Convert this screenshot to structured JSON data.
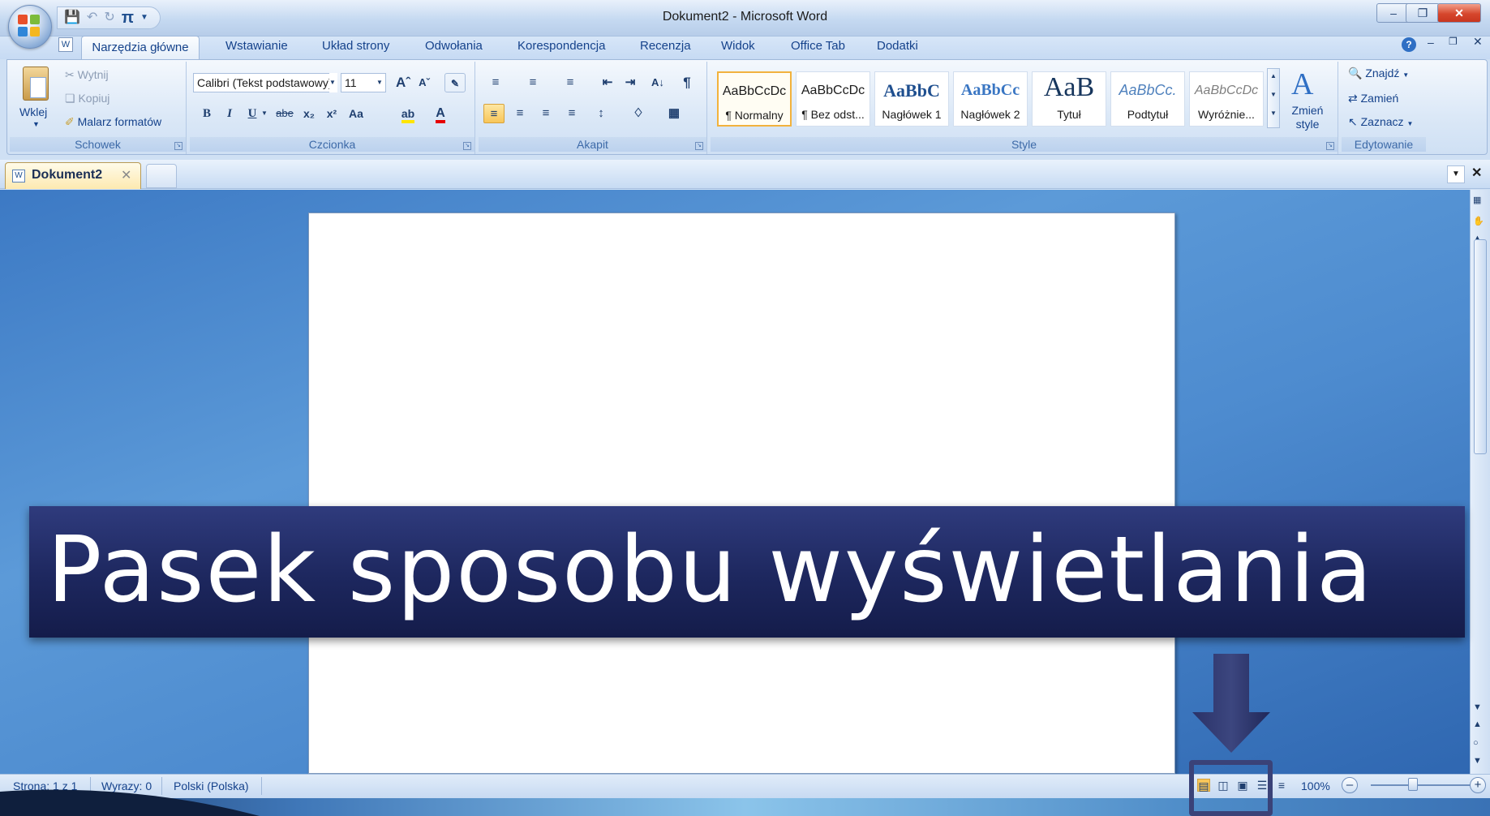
{
  "app": {
    "window_title": "Dokument2 - Microsoft Word",
    "ribbon_help_icon": "help-icon"
  },
  "qat": {
    "pi_label": "π"
  },
  "tabs": [
    "Narzędzia główne",
    "Wstawianie",
    "Układ strony",
    "Odwołania",
    "Korespondencja",
    "Recenzja",
    "Widok",
    "Office Tab",
    "Dodatki"
  ],
  "clipboard": {
    "paste": "Wklej",
    "cut": "Wytnij",
    "copy": "Kopiuj",
    "format_painter": "Malarz formatów",
    "group": "Schowek"
  },
  "font": {
    "name": "Calibri (Tekst podstawowy)",
    "size": "11",
    "bold": "B",
    "italic": "I",
    "underline": "U",
    "strike": "abe",
    "subscript": "x₂",
    "superscript": "x²",
    "case": "Aa",
    "group": "Czcionka"
  },
  "paragraph": {
    "group": "Akapit"
  },
  "styles": {
    "items": [
      {
        "sample": "AaBbCcDc",
        "name": "¶ Normalny"
      },
      {
        "sample": "AaBbCcDc",
        "name": "¶ Bez odst..."
      },
      {
        "sample": "AaBbC",
        "name": "Nagłówek 1"
      },
      {
        "sample": "AaBbCc",
        "name": "Nagłówek 2"
      },
      {
        "sample": "AaB",
        "name": "Tytuł"
      },
      {
        "sample": "AaBbCc.",
        "name": "Podtytuł"
      },
      {
        "sample": "AaBbCcDc",
        "name": "Wyróżnie..."
      }
    ],
    "change_styles": "Zmień style",
    "group": "Style"
  },
  "editing": {
    "find": "Znajdź",
    "replace": "Zamień",
    "select": "Zaznacz",
    "group": "Edytowanie"
  },
  "doc_tab": {
    "name": "Dokument2"
  },
  "status": {
    "page": "Strona: 1 z 1",
    "words": "Wyrazy: 0",
    "language": "Polski (Polska)",
    "zoom": "100%"
  },
  "banner": {
    "text": "Pasek sposobu wyświetlania"
  },
  "colors": {
    "banner": "#1d275e",
    "accent": "#15428b",
    "highlight": "#3a4278"
  }
}
